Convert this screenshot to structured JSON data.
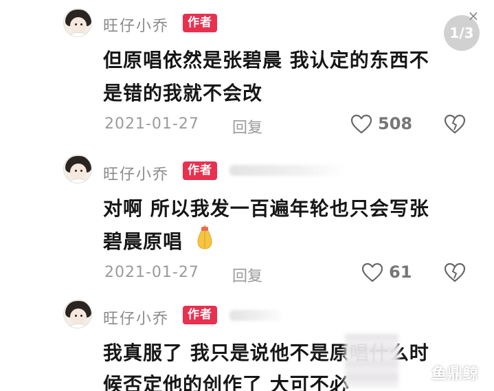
{
  "page_indicator": "1/3",
  "close_glyph": "×",
  "watermark": "鱼鼎鲸",
  "comments": [
    {
      "username": "旺仔小乔",
      "badge": "作者",
      "lines": [
        "但原唱依然是张碧晨 我认定的东西不",
        "是错的我就不会改"
      ],
      "date": "2021-01-27",
      "reply": "回复",
      "likes": "508"
    },
    {
      "username": "旺仔小乔",
      "badge": "作者",
      "lines": [
        "对啊 所以我发一百遍年轮也只会写张",
        "碧晨原唱"
      ],
      "date": "2021-01-27",
      "reply": "回复",
      "likes": "61"
    },
    {
      "username": "旺仔小乔",
      "badge": "作者",
      "lines": [
        "我真服了 我只是说他不是原唱什么时",
        "候否定他的创作了 大可不必"
      ]
    }
  ],
  "icons": {
    "like": "heart-outline-icon",
    "dislike": "broken-heart-icon",
    "emoji": "pray-hands-emoji"
  },
  "colors": {
    "badge": "#e8304f",
    "secondary_text": "#9a9a9a",
    "main_text": "#161616"
  }
}
